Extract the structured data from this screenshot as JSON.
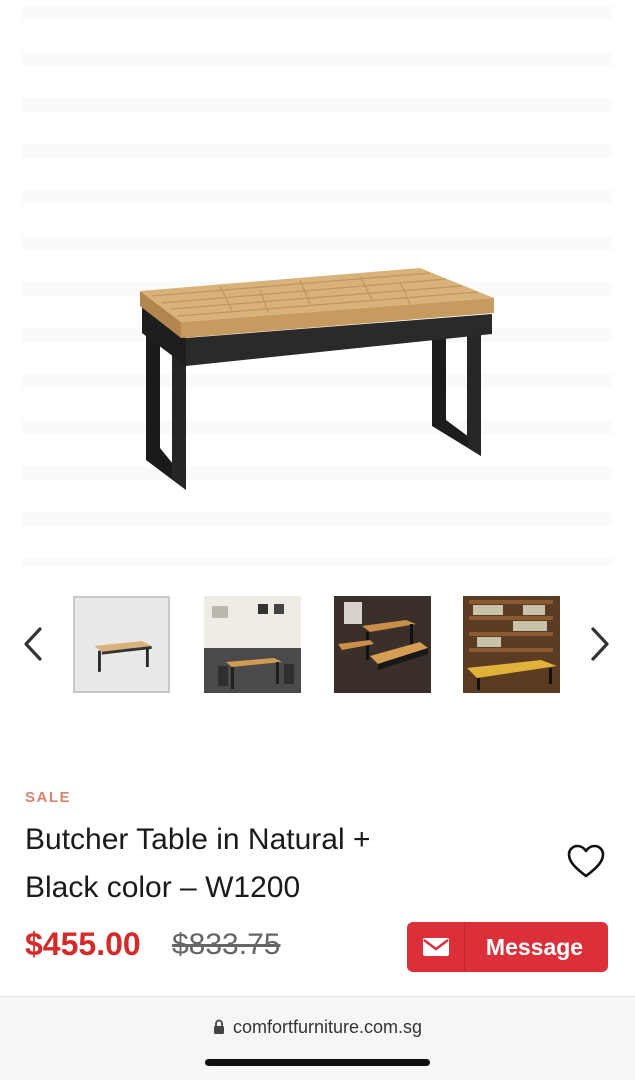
{
  "product": {
    "badge": "SALE",
    "title_line1": "Butcher Table in Natural +",
    "title_line2": "Black color – W1200",
    "price": "$455.00",
    "original_price": "$833.75"
  },
  "actions": {
    "message_label": "Message",
    "message_icon": "envelope-icon",
    "favorite_icon": "heart-outline-icon"
  },
  "gallery": {
    "prev_icon": "chevron-left-icon",
    "next_icon": "chevron-right-icon",
    "selected_index": 0,
    "thumbnail_count": 4
  },
  "browser": {
    "url": "comfortfurniture.com.sg",
    "lock_icon": "lock-icon"
  },
  "colors": {
    "sale_badge": "#d9826f",
    "price": "#d42a2a",
    "message_button": "#db2f3a"
  }
}
